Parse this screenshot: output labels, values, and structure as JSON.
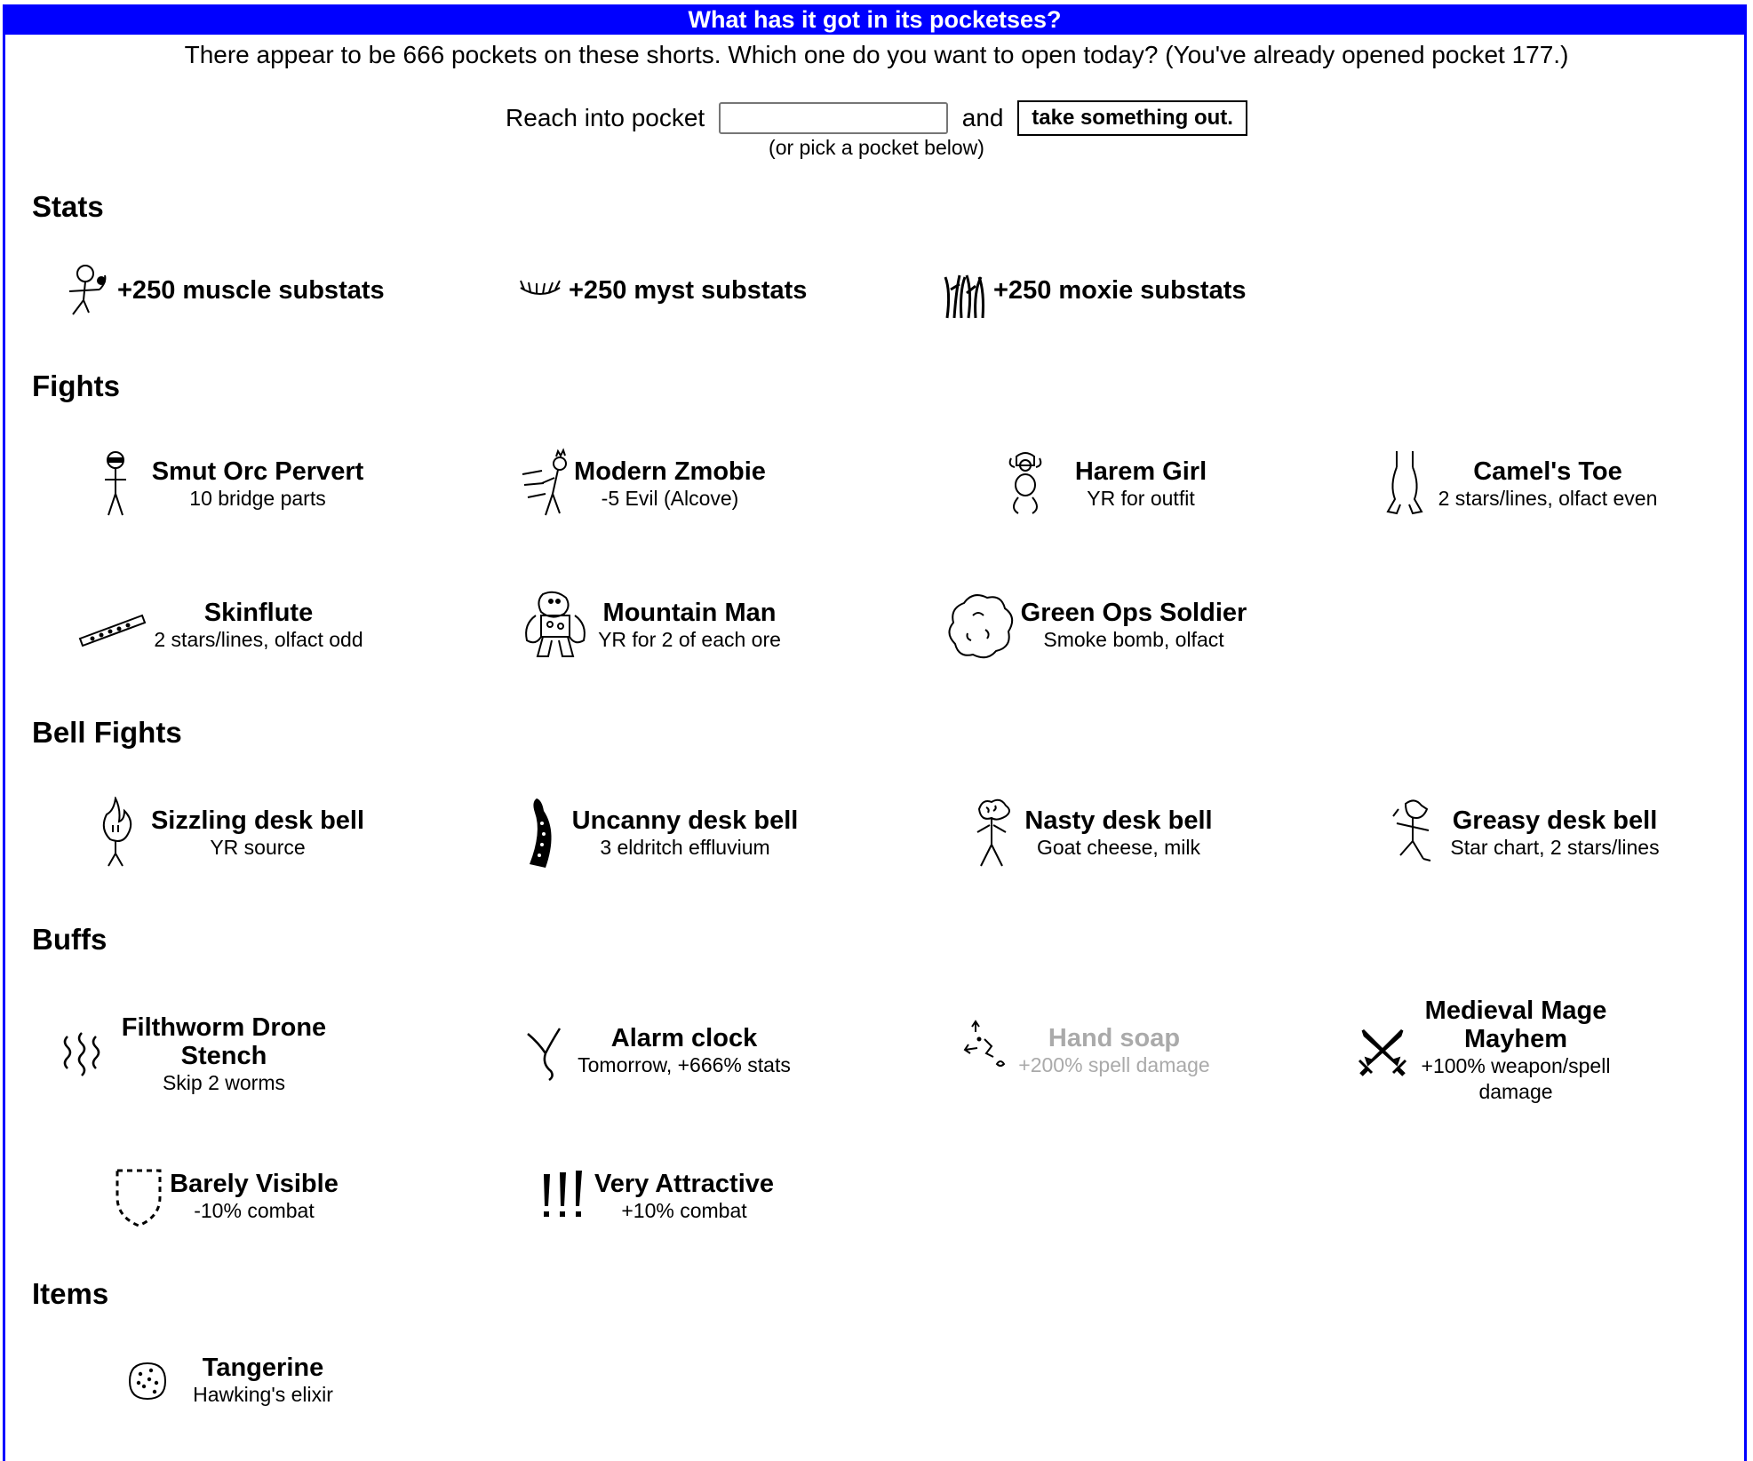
{
  "header": {
    "title": "What has it got in its pocketses?"
  },
  "intro": "There appear to be 666 pockets on these shorts. Which one do you want to open today? (You've already opened pocket 177.)",
  "form": {
    "prefix": "Reach into pocket",
    "input_value": "",
    "conjunction": "and",
    "button_label": "take something out.",
    "hint": "(or pick a pocket below)"
  },
  "sections": {
    "stats": {
      "heading": "Stats",
      "items": [
        {
          "title": "+250 muscle substats",
          "icon": "muscle-stickman-icon"
        },
        {
          "title": "+250 myst substats",
          "icon": "eyelash-icon"
        },
        {
          "title": "+250 moxie substats",
          "icon": "wild-hair-icon"
        }
      ]
    },
    "fights": {
      "heading": "Fights",
      "items": [
        {
          "title": "Smut Orc Pervert",
          "subtitle": "10 bridge parts",
          "icon": "orc-icon"
        },
        {
          "title": "Modern Zmobie",
          "subtitle": "-5 Evil (Alcove)",
          "icon": "running-zombie-icon"
        },
        {
          "title": "Harem Girl",
          "subtitle": "YR for outfit",
          "icon": "harem-girl-icon"
        },
        {
          "title": "Camel's Toe",
          "subtitle": "2 stars/lines, olfact even",
          "icon": "camel-toe-icon"
        },
        {
          "title": "Skinflute",
          "subtitle": "2 stars/lines, olfact odd",
          "icon": "flute-icon"
        },
        {
          "title": "Mountain Man",
          "subtitle": "YR for 2 of each ore",
          "icon": "rock-golem-icon"
        },
        {
          "title": "Green Ops Soldier",
          "subtitle": "Smoke bomb, olfact",
          "icon": "smoke-cloud-icon"
        }
      ]
    },
    "bell_fights": {
      "heading": "Bell Fights",
      "items": [
        {
          "title": "Sizzling desk bell",
          "subtitle": "YR source",
          "icon": "flame-creature-icon"
        },
        {
          "title": "Uncanny desk bell",
          "subtitle": "3 eldritch effluvium",
          "icon": "tentacle-icon"
        },
        {
          "title": "Nasty desk bell",
          "subtitle": "Goat cheese, milk",
          "icon": "brain-stickman-icon"
        },
        {
          "title": "Greasy desk bell",
          "subtitle": "Star chart, 2 stars/lines",
          "icon": "greasy-stickman-icon"
        }
      ]
    },
    "buffs": {
      "heading": "Buffs",
      "items": [
        {
          "title": "Filthworm Drone Stench",
          "title_lines": [
            "Filthworm Drone",
            "Stench"
          ],
          "subtitle": "Skip 2 worms",
          "icon": "stench-waves-icon"
        },
        {
          "title": "Alarm clock",
          "subtitle": "Tomorrow, +666% stats",
          "icon": "forked-branch-icon"
        },
        {
          "title": "Hand soap",
          "subtitle": "+200% spell damage",
          "icon": "scattered-arrows-icon",
          "disabled": true
        },
        {
          "title": "Medieval Mage Mayhem",
          "title_lines": [
            "Medieval Mage",
            "Mayhem"
          ],
          "subtitle": "+100% weapon/spell damage",
          "subtitle_lines": [
            "+100% weapon/spell",
            "damage"
          ],
          "icon": "crossed-swords-icon"
        },
        {
          "title": "Barely Visible",
          "subtitle": "-10% combat",
          "icon": "dashed-shield-icon"
        },
        {
          "title": "Very Attractive",
          "subtitle": "+10% combat",
          "icon": "exclamation-marks-icon"
        }
      ]
    },
    "items": {
      "heading": "Items",
      "items": [
        {
          "title": "Tangerine",
          "subtitle": "Hawking's elixir",
          "icon": "tangerine-icon"
        }
      ]
    }
  },
  "colors": {
    "title_bar": "#0000ff",
    "disabled_text": "#aaaaaa"
  }
}
